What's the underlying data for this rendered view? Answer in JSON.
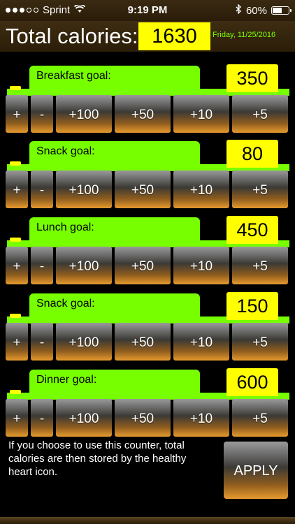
{
  "status_bar": {
    "carrier": "Sprint",
    "time": "9:19 PM",
    "battery": "60%",
    "battery_level": 0.6
  },
  "header": {
    "title": "Total calories:",
    "total": "1630",
    "date": "Friday,  11/25/2016"
  },
  "buttons": [
    "+",
    "-",
    "+100",
    "+50",
    "+10",
    "+5"
  ],
  "meals": [
    {
      "label": "Breakfast goal:",
      "value": "350"
    },
    {
      "label": "Snack goal:",
      "value": "80"
    },
    {
      "label": "Lunch goal:",
      "value": "450"
    },
    {
      "label": "Snack goal:",
      "value": "150"
    },
    {
      "label": "Dinner goal:",
      "value": "600"
    }
  ],
  "footer": {
    "info": "If you choose to use this counter, total calories are then stored by the healthy heart icon.",
    "apply_label": "APPLY"
  },
  "colors": {
    "accent_green": "#77ff00",
    "highlight_yellow": "#ffff00",
    "bar_brown": "#2b1d08"
  },
  "icons": [
    "signal-icon",
    "wifi-icon",
    "bluetooth-icon",
    "battery-icon"
  ]
}
